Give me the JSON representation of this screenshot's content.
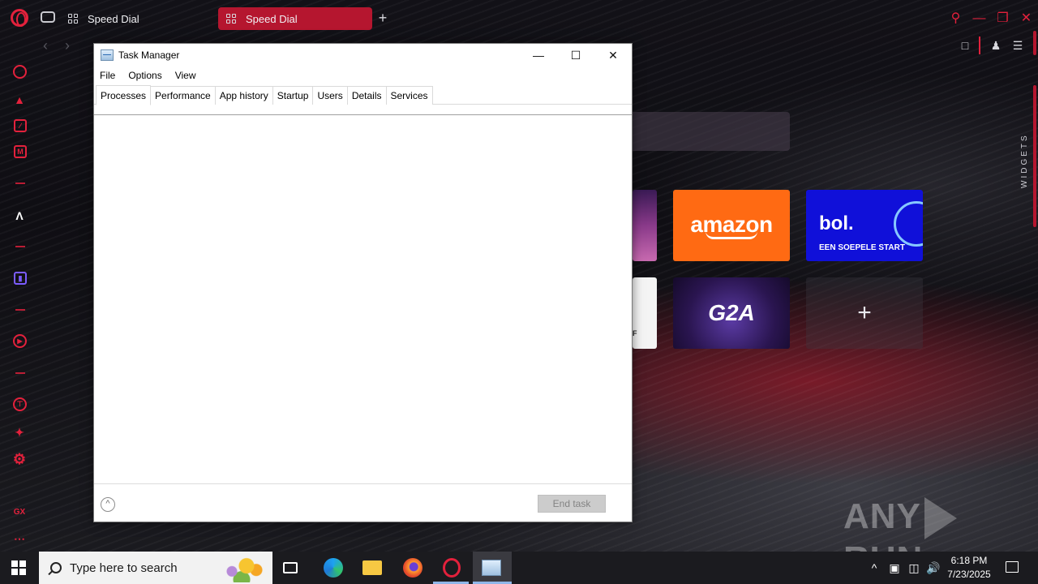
{
  "browser": {
    "tabs": [
      {
        "label": "Speed Dial"
      },
      {
        "label": "Speed Dial"
      }
    ],
    "new_tab_glyph": "+",
    "widgets_label": "WIDGETS",
    "speed_dials": {
      "amazon": "amazon",
      "bol_logo": "bol.",
      "bol_slogan": "EEN SOEPELE START",
      "g2a": "G2A",
      "add": "+",
      "partial_text": "F"
    },
    "accent_color": "#e3213c",
    "active_tab_color": "#b5162f"
  },
  "task_manager": {
    "title": "Task Manager",
    "menu": [
      "File",
      "Options",
      "View"
    ],
    "tabs": [
      "Processes",
      "Performance",
      "App history",
      "Startup",
      "Users",
      "Details",
      "Services"
    ],
    "active_tab": "Processes",
    "end_task_label": "End task",
    "controls": {
      "minimize": "—",
      "maximize": "☐",
      "close": "✕"
    }
  },
  "taskbar": {
    "search_placeholder": "Type here to search",
    "time": "6:18 PM",
    "date": "7/23/2025",
    "tray_chevron": "^"
  },
  "watermark": {
    "left": "ANY",
    "right": "RUN"
  }
}
